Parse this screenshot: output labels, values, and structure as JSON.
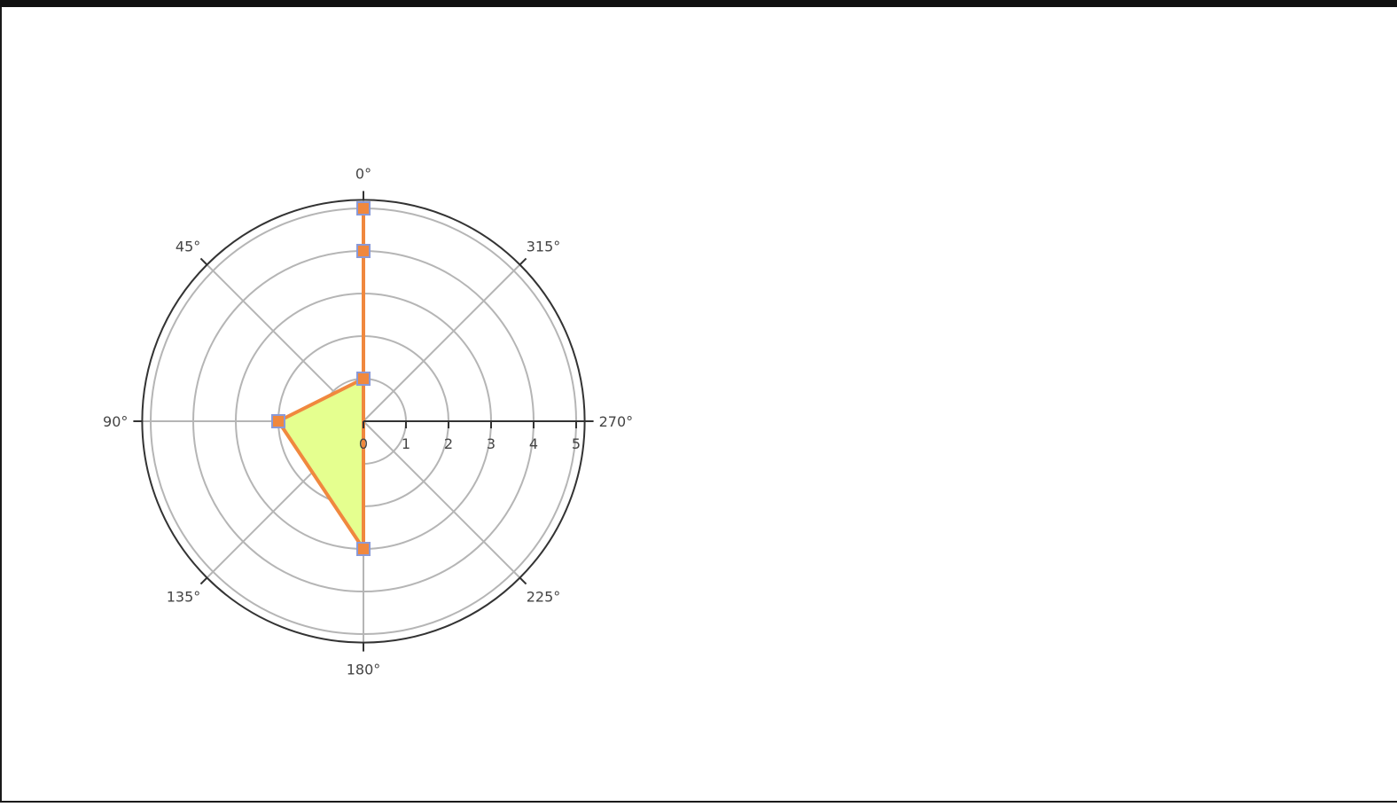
{
  "chart_data": {
    "type": "polar",
    "theta_unit": "degrees",
    "angular_direction": "clockwise",
    "angular_rotation": 90,
    "angular_tick_labels": [
      "0°",
      "45°",
      "90°",
      "135°",
      "180°",
      "225°",
      "270°",
      "315°"
    ],
    "radial_ticks": [
      0,
      1,
      2,
      3,
      4,
      5
    ],
    "radial_tick_labels": [
      "0",
      "1",
      "2",
      "3",
      "4",
      "5"
    ],
    "radial_range": [
      0,
      5.2
    ],
    "grid": true,
    "series": [
      {
        "mode": "lines+markers",
        "fill": "toself",
        "r": [
          5,
          4,
          1,
          2,
          3
        ],
        "theta": [
          0,
          0,
          0,
          90,
          180
        ]
      }
    ],
    "colors": {
      "fill": "#e5ff8f",
      "line": "#f0883e",
      "marker_face": "#f0883e",
      "marker_edge": "#8a9ad8",
      "grid": "#b5b5b5",
      "axis": "#333333"
    }
  }
}
